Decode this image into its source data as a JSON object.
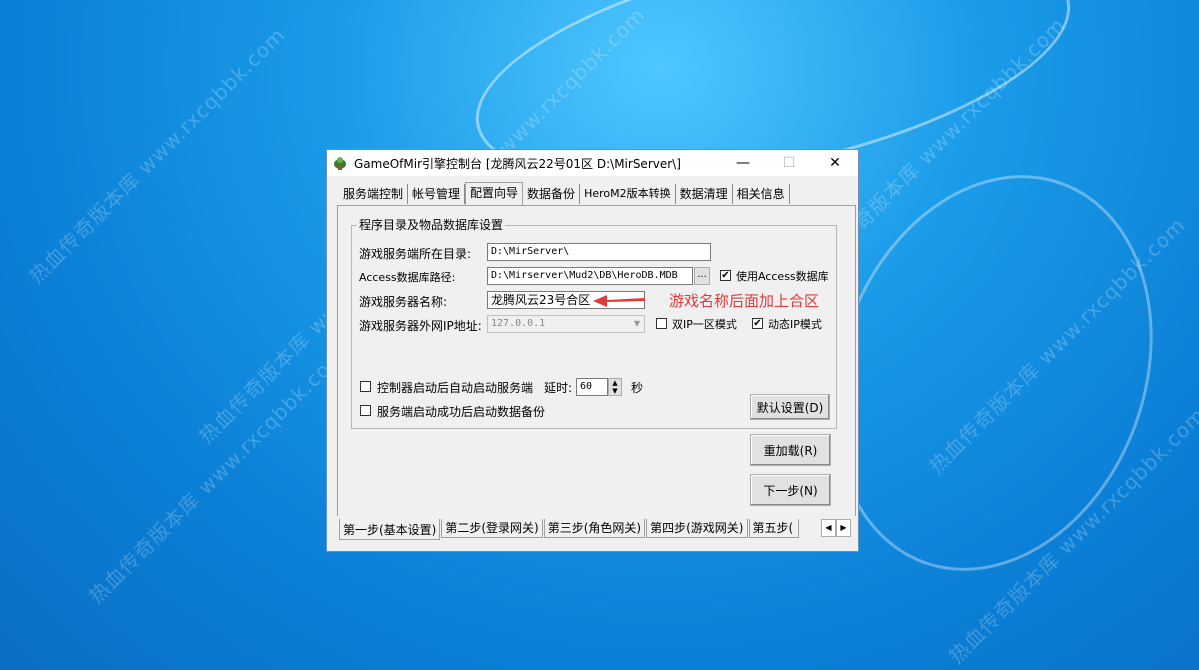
{
  "watermark": "热血传奇版本库 www.rxcqbbk.com",
  "window": {
    "title": "GameOfMir引擎控制台 [龙腾风云22号01区 D:\\MirServer\\]",
    "min_glyph": "—",
    "max_glyph": "☐",
    "close_glyph": "✕"
  },
  "top_tabs": [
    "服务端控制",
    "帐号管理",
    "配置向导",
    "数据备份",
    "HeroM2版本转换",
    "数据清理",
    "相关信息"
  ],
  "group": {
    "title": "程序目录及物品数据库设置",
    "server_dir_label": "游戏服务端所在目录:",
    "server_dir_value": "D:\\MirServer\\",
    "access_path_label": "Access数据库路径:",
    "access_path_value": "D:\\Mirserver\\Mud2\\DB\\HeroDB.MDB",
    "browse_label": "...",
    "use_access_label": "使用Access数据库",
    "use_access_checked": true,
    "server_name_label": "游戏服务器名称:",
    "server_name_value": "龙腾风云23号合区",
    "ip_label": "游戏服务器外网IP地址:",
    "ip_value": "127.0.0.1",
    "dual_ip_label": "双IP一区模式",
    "dual_ip_checked": false,
    "dynamic_ip_label": "动态IP模式",
    "dynamic_ip_checked": true,
    "autostart_label": "控制器启动后自动启动服务端",
    "autostart_checked": false,
    "delay_label": "延时:",
    "delay_value": "60",
    "delay_unit": "秒",
    "autobackup_label": "服务端启动成功后启动数据备份",
    "autobackup_checked": false,
    "default_button": "默认设置(D)"
  },
  "annotation": "游戏名称后面加上合区",
  "buttons": {
    "reload": "重加载(R)",
    "next": "下一步(N)"
  },
  "bottom_tabs": [
    "第一步(基本设置)",
    "第二步(登录网关)",
    "第三步(角色网关)",
    "第四步(游戏网关)",
    "第五步("
  ],
  "colors": {
    "annotation": "#e23b3b",
    "desktop": "#1a9be8"
  }
}
